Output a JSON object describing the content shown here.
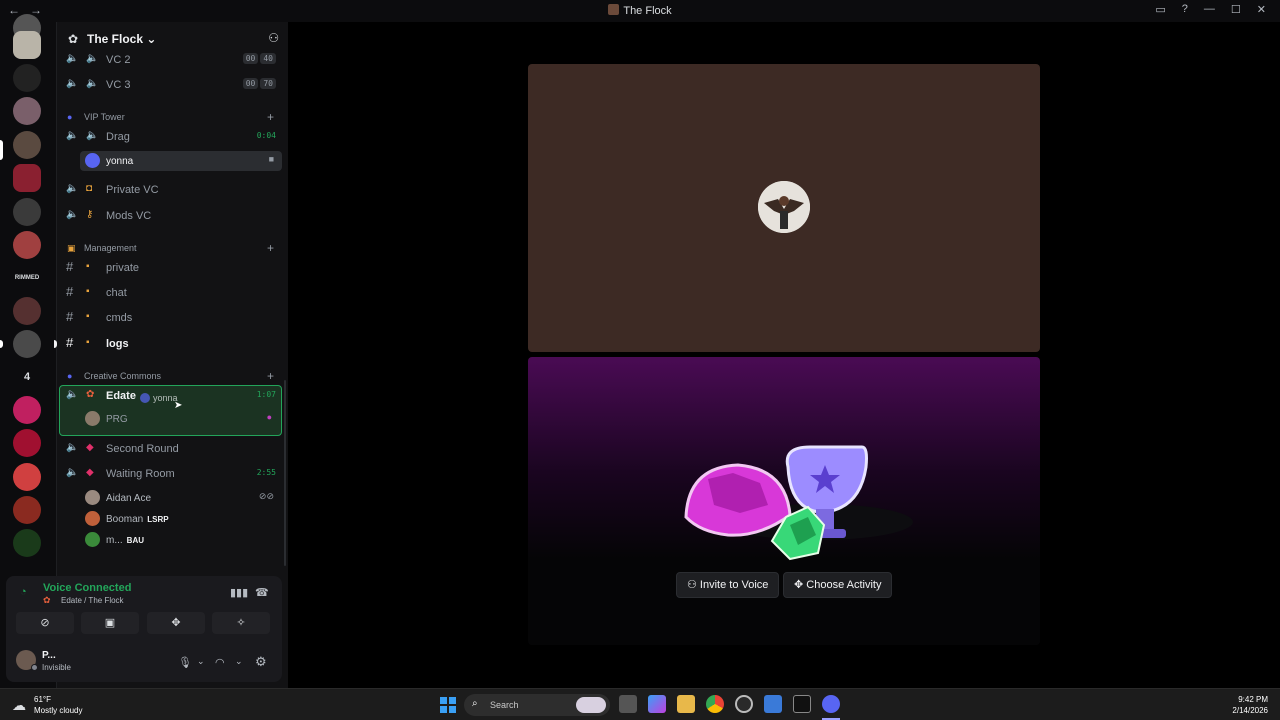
{
  "window": {
    "title": "The Flock",
    "nav_back": "←",
    "nav_fwd": "→",
    "controls": [
      "▭",
      "?",
      "—",
      "☐",
      "✕"
    ]
  },
  "rail": {
    "text_items": [
      "RIMMED",
      "4"
    ]
  },
  "guild": {
    "name": "The Flock",
    "chevron": "⌄",
    "invite_icon": "person-add-icon"
  },
  "channels": {
    "vc2": {
      "name": "VC 2",
      "a": "00",
      "b": "40"
    },
    "vc3": {
      "name": "VC 3",
      "a": "00",
      "b": "70"
    },
    "cat_vip": {
      "name": "VIP Tower"
    },
    "drag": {
      "name": "Drag",
      "timer": "0:04"
    },
    "drag_user": {
      "name": "yonna"
    },
    "private_vc": {
      "name": "Private VC"
    },
    "mods_vc": {
      "name": "Mods VC"
    },
    "cat_mgmt": {
      "name": "Management"
    },
    "private": {
      "name": "private"
    },
    "chat": {
      "name": "chat"
    },
    "cmds": {
      "name": "cmds"
    },
    "logs": {
      "name": "logs"
    },
    "cat_creative": {
      "name": "Creative Commons"
    },
    "edate": {
      "name": "Edate",
      "timer": "1:07"
    },
    "edate_user": {
      "name": "PRG"
    },
    "drag_ghost": {
      "name": "yonna"
    },
    "second_round": {
      "name": "Second Round"
    },
    "waiting_room": {
      "name": "Waiting Room",
      "timer": "2:55"
    },
    "wr_users": [
      {
        "name": "Aidan Ace",
        "badge": ""
      },
      {
        "name": "Booman",
        "badge": "LSRP"
      },
      {
        "name": "m...",
        "badge": "BAU"
      }
    ]
  },
  "voice_panel": {
    "status": "Voice Connected",
    "location": "Edate / The Flock"
  },
  "me": {
    "name": "P...",
    "status": "Invisible"
  },
  "activity": {
    "invite_label": "Invite to Voice",
    "choose_label": "Choose Activity"
  },
  "taskbar": {
    "temp": "61°F",
    "weather": "Mostly cloudy",
    "search_placeholder": "Search",
    "time": "9:42 PM",
    "date": "2/14/2026"
  },
  "colors": {
    "accent_green": "#23a55a",
    "stage_bg": "#3d2a24",
    "activity_purple": "#4a0b54"
  }
}
